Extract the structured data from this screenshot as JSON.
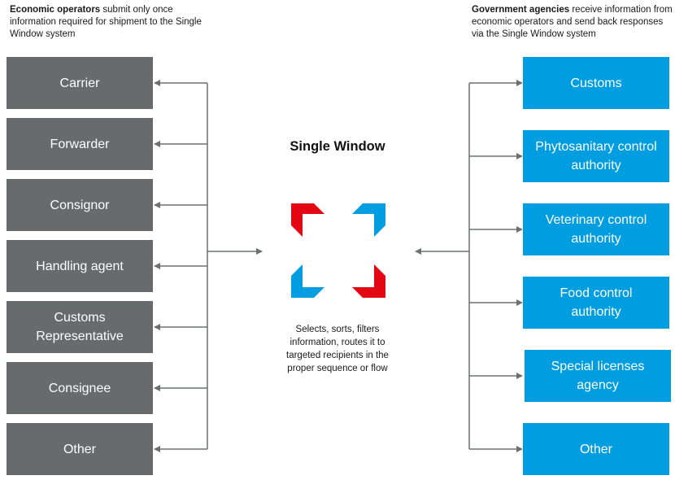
{
  "left_caption": {
    "bold": "Economic operators",
    "text": " submit only once information required for shipment to the Single Window system"
  },
  "right_caption": {
    "bold": "Government agencies",
    "text": " receive information from economic operators and send back responses via the Single Window system"
  },
  "center": {
    "title": "Single Window",
    "description": "Selects, sorts, filters information, routes it to targeted recipients in the proper sequence or flow",
    "logo_icon": "four-corner-brackets-icon",
    "logo_colors": {
      "red": "#e30613",
      "blue": "#009ee0"
    }
  },
  "economic_operators": [
    {
      "label": "Carrier"
    },
    {
      "label": "Forwarder"
    },
    {
      "label": "Consignor"
    },
    {
      "label": "Handling agent"
    },
    {
      "label": "Customs Representative"
    },
    {
      "label": "Consignee"
    },
    {
      "label": "Other"
    }
  ],
  "government_agencies": [
    {
      "label": "Customs"
    },
    {
      "label": "Phytosanitary control authority"
    },
    {
      "label": "Veterinary control authority"
    },
    {
      "label": "Food control authority"
    },
    {
      "label": "Special licenses agency"
    },
    {
      "label": "Other"
    }
  ],
  "colors": {
    "operator_box": "#676b6b",
    "agency_box": "#009ee0",
    "connector": "#6d7070"
  }
}
